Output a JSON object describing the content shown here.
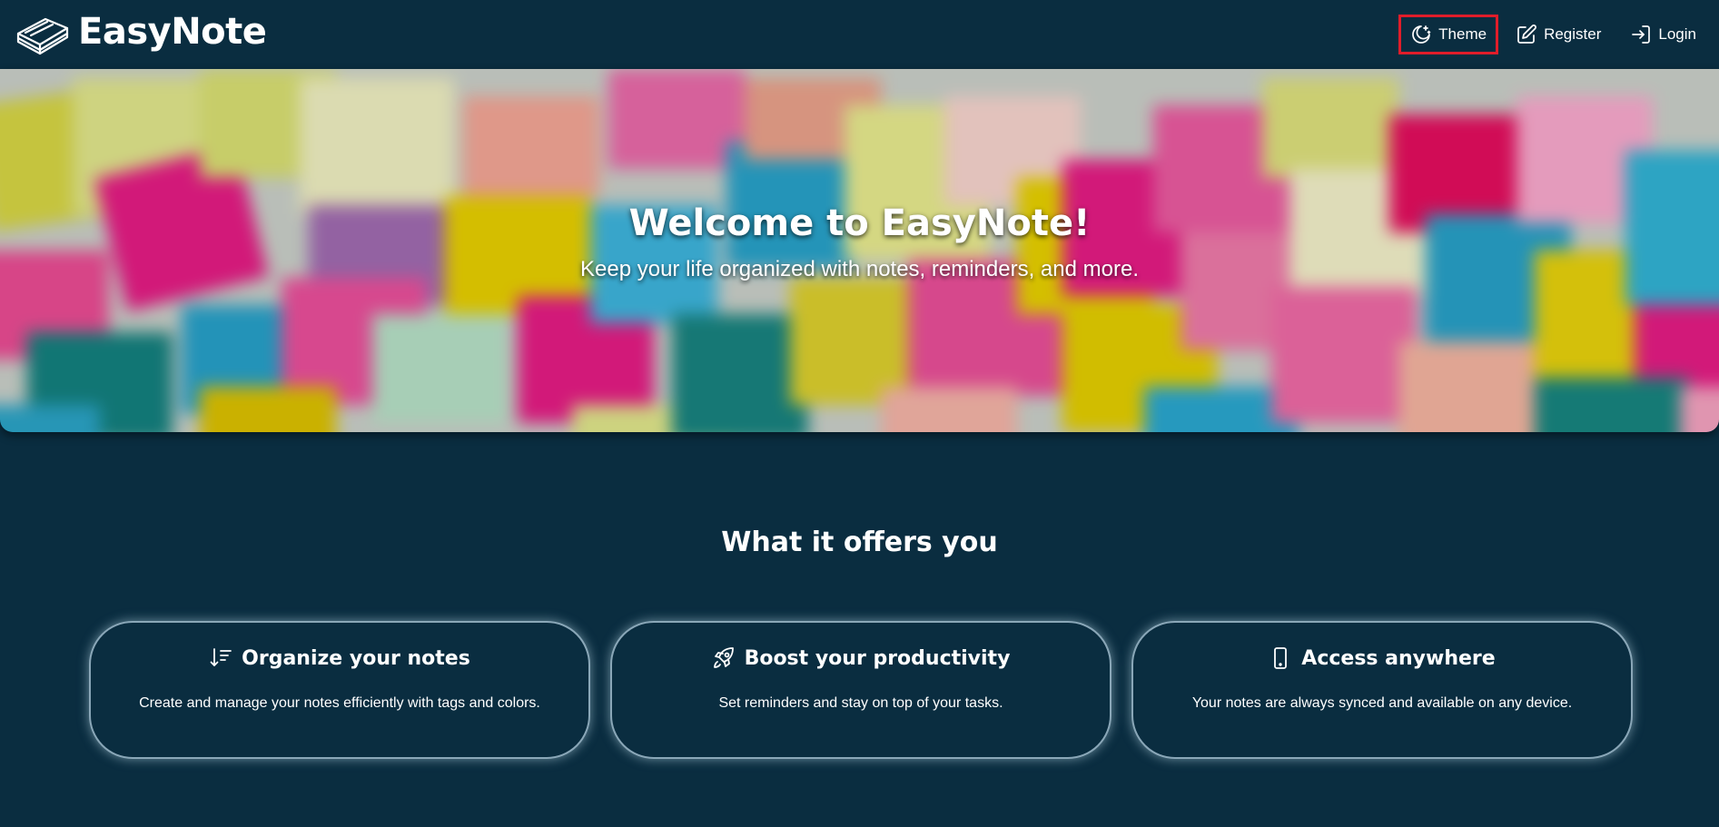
{
  "brand": {
    "name": "EasyNote",
    "logo_icon": "notebook-stack-icon"
  },
  "nav": {
    "theme": {
      "label": "Theme",
      "icon": "moon-stars-icon"
    },
    "register": {
      "label": "Register",
      "icon": "pencil-square-icon"
    },
    "login": {
      "label": "Login",
      "icon": "login-arrow-icon"
    }
  },
  "hero": {
    "title": "Welcome to EasyNote!",
    "subtitle": "Keep your life organized with notes, reminders, and more.",
    "background": "blurred-sticky-notes-image"
  },
  "features": {
    "title": "What it offers you",
    "cards": [
      {
        "icon": "sort-descending-icon",
        "title": "Organize your notes",
        "description": "Create and manage your notes efficiently with tags and colors."
      },
      {
        "icon": "rocket-icon",
        "title": "Boost your productivity",
        "description": "Set reminders and stay on top of your tasks."
      },
      {
        "icon": "phone-icon",
        "title": "Access anywhere",
        "description": "Your notes are always synced and available on any device."
      }
    ]
  },
  "colors": {
    "background": "#0a2d40",
    "highlight_border": "#e01d2a",
    "card_border": "#8aa7b8",
    "text": "#ffffff"
  }
}
